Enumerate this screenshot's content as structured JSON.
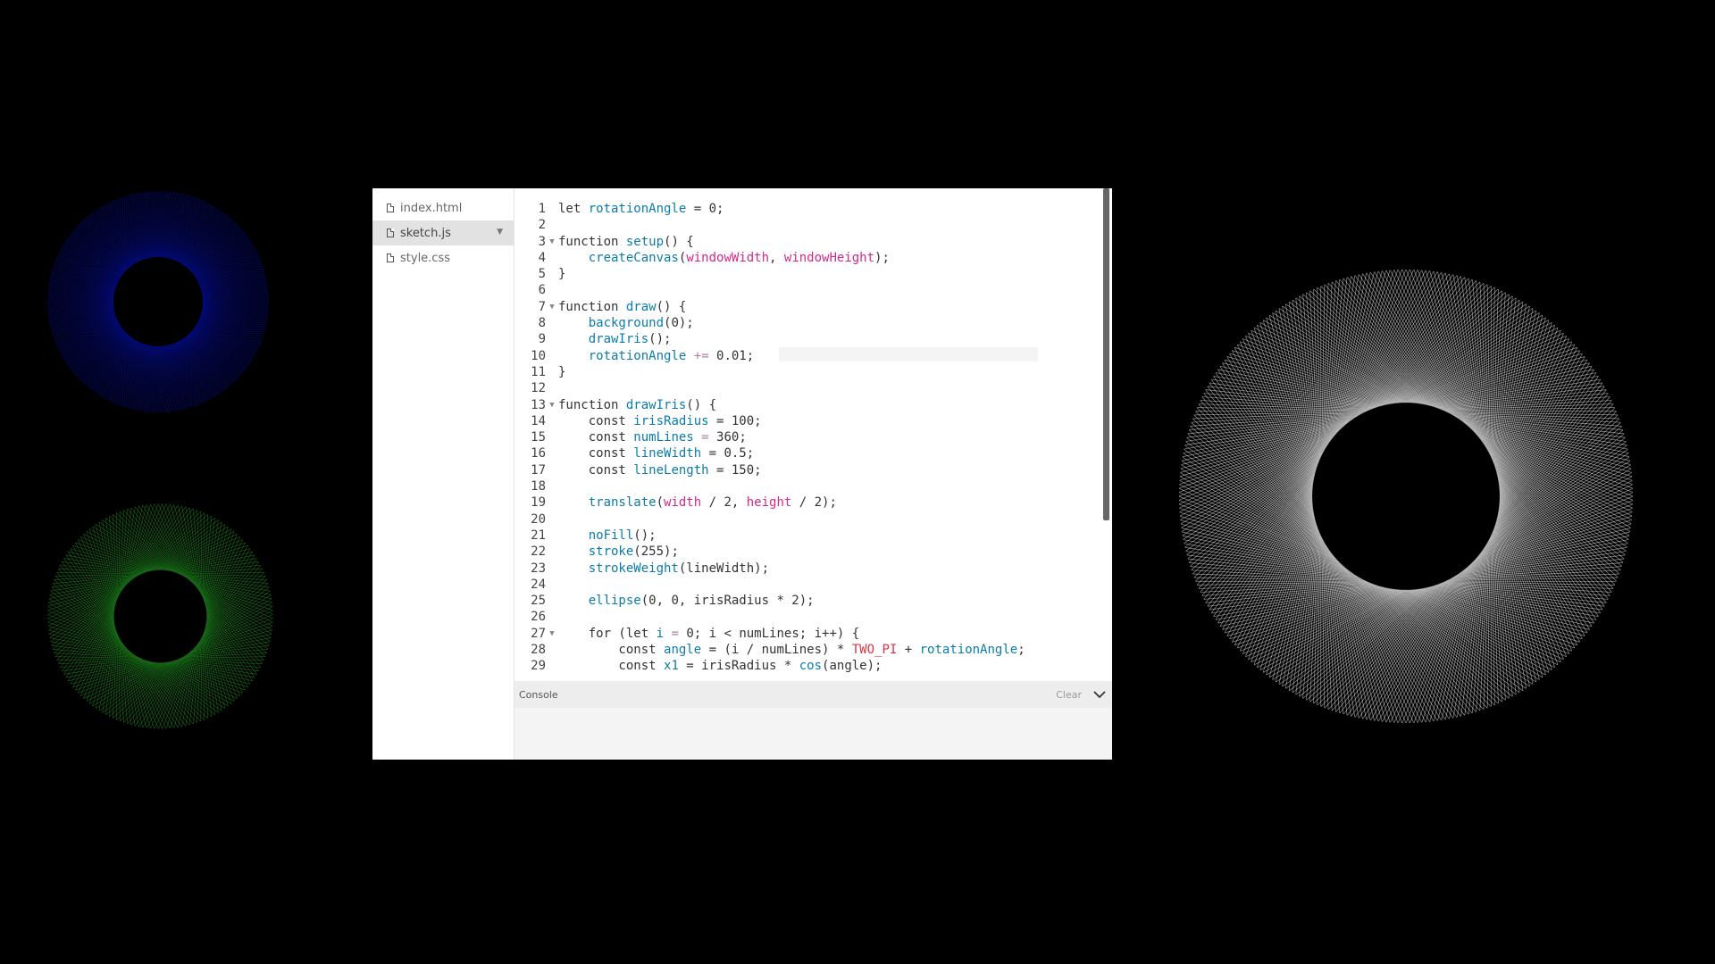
{
  "files": [
    {
      "name": "index.html",
      "active": false
    },
    {
      "name": "sketch.js",
      "active": true
    },
    {
      "name": "style.css",
      "active": false
    }
  ],
  "code_lines": [
    {
      "num": "1",
      "fold": "",
      "tokens": [
        [
          "t-kw",
          "let "
        ],
        [
          "t-var",
          "rotationAngle"
        ],
        [
          "t-plain",
          " = 0;"
        ]
      ]
    },
    {
      "num": "2",
      "fold": "",
      "tokens": []
    },
    {
      "num": "3",
      "fold": "▼",
      "tokens": [
        [
          "t-kw",
          "function "
        ],
        [
          "t-fn",
          "setup"
        ],
        [
          "t-plain",
          "() {"
        ]
      ]
    },
    {
      "num": "4",
      "fold": "",
      "tokens": [
        [
          "t-plain",
          "    "
        ],
        [
          "t-fn",
          "createCanvas"
        ],
        [
          "t-plain",
          "("
        ],
        [
          "t-pink",
          "windowWidth"
        ],
        [
          "t-plain",
          ", "
        ],
        [
          "t-pink",
          "windowHeight"
        ],
        [
          "t-plain",
          ");"
        ]
      ]
    },
    {
      "num": "5",
      "fold": "",
      "tokens": [
        [
          "t-plain",
          "}"
        ]
      ]
    },
    {
      "num": "6",
      "fold": "",
      "tokens": []
    },
    {
      "num": "7",
      "fold": "▼",
      "tokens": [
        [
          "t-kw",
          "function "
        ],
        [
          "t-fn",
          "draw"
        ],
        [
          "t-plain",
          "() {"
        ]
      ]
    },
    {
      "num": "8",
      "fold": "",
      "tokens": [
        [
          "t-plain",
          "    "
        ],
        [
          "t-fn",
          "background"
        ],
        [
          "t-plain",
          "(0);"
        ]
      ]
    },
    {
      "num": "9",
      "fold": "",
      "tokens": [
        [
          "t-plain",
          "    "
        ],
        [
          "t-var",
          "drawIris"
        ],
        [
          "t-plain",
          "();"
        ]
      ]
    },
    {
      "num": "10",
      "fold": "",
      "tokens": [
        [
          "t-plain",
          "    "
        ],
        [
          "t-var",
          "rotationAngle"
        ],
        [
          "t-op",
          " += "
        ],
        [
          "t-plain",
          "0.01;"
        ]
      ]
    },
    {
      "num": "11",
      "fold": "",
      "tokens": [
        [
          "t-plain",
          "}"
        ]
      ]
    },
    {
      "num": "12",
      "fold": "",
      "tokens": []
    },
    {
      "num": "13",
      "fold": "▼",
      "tokens": [
        [
          "t-kw",
          "function "
        ],
        [
          "t-var",
          "drawIris"
        ],
        [
          "t-plain",
          "() {"
        ]
      ]
    },
    {
      "num": "14",
      "fold": "",
      "tokens": [
        [
          "t-plain",
          "    const "
        ],
        [
          "t-var",
          "irisRadius"
        ],
        [
          "t-plain",
          " = 100;"
        ]
      ]
    },
    {
      "num": "15",
      "fold": "",
      "tokens": [
        [
          "t-plain",
          "    const "
        ],
        [
          "t-var",
          "numLines"
        ],
        [
          "t-op",
          " = "
        ],
        [
          "t-plain",
          "360;"
        ]
      ]
    },
    {
      "num": "16",
      "fold": "",
      "tokens": [
        [
          "t-plain",
          "    const "
        ],
        [
          "t-var",
          "lineWidth"
        ],
        [
          "t-plain",
          " = 0.5;"
        ]
      ]
    },
    {
      "num": "17",
      "fold": "",
      "tokens": [
        [
          "t-plain",
          "    const "
        ],
        [
          "t-var",
          "lineLength"
        ],
        [
          "t-plain",
          " = 150;"
        ]
      ]
    },
    {
      "num": "18",
      "fold": "",
      "tokens": []
    },
    {
      "num": "19",
      "fold": "",
      "tokens": [
        [
          "t-plain",
          "    "
        ],
        [
          "t-fn",
          "translate"
        ],
        [
          "t-plain",
          "("
        ],
        [
          "t-pink",
          "width"
        ],
        [
          "t-plain",
          " / 2, "
        ],
        [
          "t-pink",
          "height"
        ],
        [
          "t-plain",
          " / 2);"
        ]
      ]
    },
    {
      "num": "20",
      "fold": "",
      "tokens": []
    },
    {
      "num": "21",
      "fold": "",
      "tokens": [
        [
          "t-plain",
          "    "
        ],
        [
          "t-fn",
          "noFill"
        ],
        [
          "t-plain",
          "();"
        ]
      ]
    },
    {
      "num": "22",
      "fold": "",
      "tokens": [
        [
          "t-plain",
          "    "
        ],
        [
          "t-fn",
          "stroke"
        ],
        [
          "t-plain",
          "(255);"
        ]
      ]
    },
    {
      "num": "23",
      "fold": "",
      "tokens": [
        [
          "t-plain",
          "    "
        ],
        [
          "t-fn",
          "strokeWeight"
        ],
        [
          "t-plain",
          "(lineWidth);"
        ]
      ]
    },
    {
      "num": "24",
      "fold": "",
      "tokens": []
    },
    {
      "num": "25",
      "fold": "",
      "tokens": [
        [
          "t-plain",
          "    "
        ],
        [
          "t-fn",
          "ellipse"
        ],
        [
          "t-plain",
          "(0, 0, irisRadius * 2);"
        ]
      ]
    },
    {
      "num": "26",
      "fold": "",
      "tokens": []
    },
    {
      "num": "27",
      "fold": "▼",
      "tokens": [
        [
          "t-plain",
          "    for (let "
        ],
        [
          "t-var",
          "i"
        ],
        [
          "t-op",
          " = "
        ],
        [
          "t-plain",
          "0; i < numLines; i++) {"
        ]
      ]
    },
    {
      "num": "28",
      "fold": "",
      "tokens": [
        [
          "t-plain",
          "        const "
        ],
        [
          "t-var",
          "angle"
        ],
        [
          "t-plain",
          " = (i / numLines) * "
        ],
        [
          "t-red",
          "TWO_PI"
        ],
        [
          "t-plain",
          " + "
        ],
        [
          "t-var",
          "rotationAngle"
        ],
        [
          "t-plain",
          ";"
        ]
      ]
    },
    {
      "num": "29",
      "fold": "",
      "tokens": [
        [
          "t-plain",
          "        const "
        ],
        [
          "t-var",
          "x1"
        ],
        [
          "t-plain",
          " = irisRadius * "
        ],
        [
          "t-fn",
          "cos"
        ],
        [
          "t-plain",
          "(angle);"
        ]
      ]
    }
  ],
  "console": {
    "label": "Console",
    "clear": "Clear"
  },
  "colors": {
    "iris_blue": "#0a14c8",
    "iris_green": "#1f8a1f",
    "iris_white": "#ffffff"
  },
  "icons": {
    "file": "file-icon",
    "caret": "caret-down-icon",
    "chevron": "chevron-down-icon"
  }
}
